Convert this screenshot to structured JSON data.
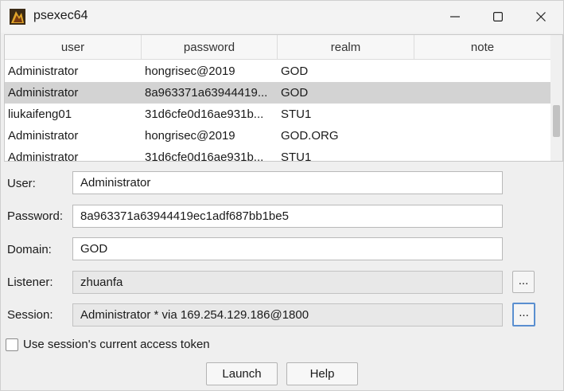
{
  "window": {
    "title": "psexec64",
    "icon": "cobalt-strike-app-icon"
  },
  "table": {
    "columns": [
      "user",
      "password",
      "realm",
      "note"
    ],
    "rows": [
      {
        "user": "Administrator",
        "password": "hongrisec@2019",
        "realm": "GOD",
        "note": ""
      },
      {
        "user": "Administrator",
        "password": "8a963371a63944419...",
        "realm": "GOD",
        "note": "",
        "selected": true
      },
      {
        "user": "liukaifeng01",
        "password": "31d6cfe0d16ae931b...",
        "realm": "STU1",
        "note": ""
      },
      {
        "user": "Administrator",
        "password": "hongrisec@2019",
        "realm": "GOD.ORG",
        "note": ""
      },
      {
        "user": "Administrator",
        "password": "31d6cfe0d16ae931b...",
        "realm": "STU1",
        "note": ""
      }
    ]
  },
  "form": {
    "user_label": "User:",
    "user_value": "Administrator",
    "password_label": "Password:",
    "password_value": "8a963371a63944419ec1adf687bb1be5",
    "domain_label": "Domain:",
    "domain_value": "GOD",
    "listener_label": "Listener:",
    "listener_value": "zhuanfa",
    "session_label": "Session:",
    "session_value": "Administrator * via  169.254.129.186@1800",
    "browse_label": "...",
    "token_checkbox_label": "Use session's current access token",
    "token_checked": false
  },
  "buttons": {
    "launch": "Launch",
    "help": "Help"
  }
}
